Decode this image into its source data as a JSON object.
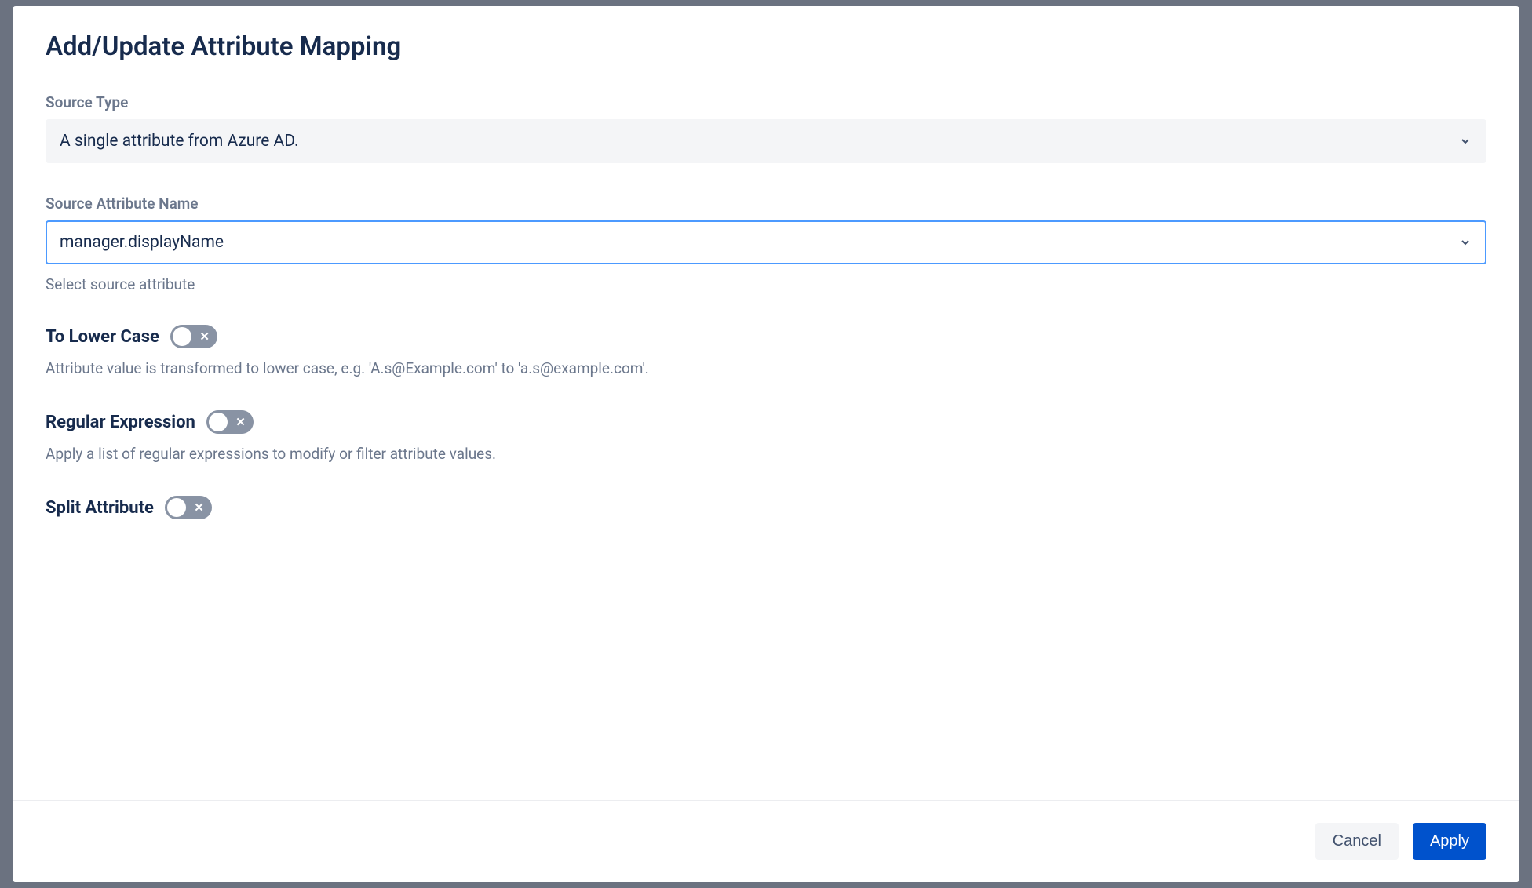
{
  "modal": {
    "title": "Add/Update Attribute Mapping",
    "sourceType": {
      "label": "Source Type",
      "value": "A single attribute from Azure AD."
    },
    "sourceAttributeName": {
      "label": "Source Attribute Name",
      "value": "manager.displayName",
      "helper": "Select source attribute"
    },
    "toggles": {
      "toLowerCase": {
        "title": "To Lower Case",
        "desc": "Attribute value is transformed to lower case, e.g. 'A.s@Example.com' to 'a.s@example.com'."
      },
      "regularExpression": {
        "title": "Regular Expression",
        "desc": "Apply a list of regular expressions to modify or filter attribute values."
      },
      "splitAttribute": {
        "title": "Split Attribute"
      }
    },
    "footer": {
      "cancel": "Cancel",
      "apply": "Apply"
    }
  }
}
